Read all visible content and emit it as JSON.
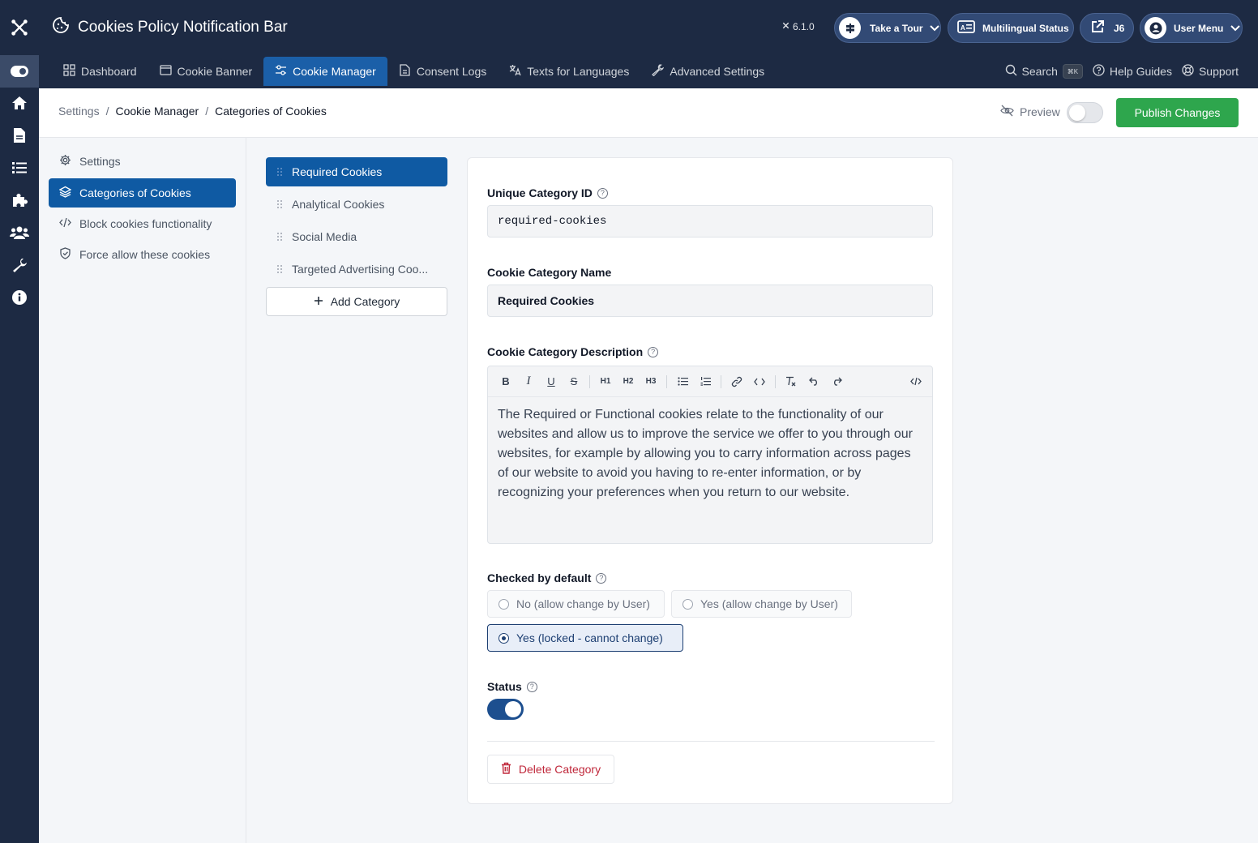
{
  "app": {
    "title": "Cookies Policy Notification Bar",
    "version": "6.1.0"
  },
  "header_pills": {
    "tour": "Take a Tour",
    "multilingual": "Multilingual Status",
    "site": "J6",
    "user": "User Menu"
  },
  "nav": {
    "tabs": [
      {
        "label": "Dashboard",
        "icon": "grid-icon"
      },
      {
        "label": "Cookie Banner",
        "icon": "window-icon"
      },
      {
        "label": "Cookie Manager",
        "icon": "sliders-icon",
        "active": true
      },
      {
        "label": "Consent Logs",
        "icon": "document-icon"
      },
      {
        "label": "Texts for Languages",
        "icon": "translate-icon"
      },
      {
        "label": "Advanced Settings",
        "icon": "wrench-icon"
      }
    ],
    "search": "Search",
    "search_kbd": "⌘K",
    "help": "Help Guides",
    "support": "Support"
  },
  "breadcrumb": [
    "Settings",
    "Cookie Manager",
    "Categories of Cookies"
  ],
  "preview_label": "Preview",
  "publish_label": "Publish Changes",
  "sidebar": {
    "items": [
      {
        "label": "Settings",
        "icon": "gear-icon"
      },
      {
        "label": "Categories of Cookies",
        "icon": "layers-icon",
        "active": true
      },
      {
        "label": "Block cookies functionality",
        "icon": "code-icon"
      },
      {
        "label": "Force allow these cookies",
        "icon": "shield-icon"
      }
    ]
  },
  "categories": {
    "items": [
      {
        "label": "Required Cookies",
        "active": true
      },
      {
        "label": "Analytical Cookies"
      },
      {
        "label": "Social Media"
      },
      {
        "label": "Targeted Advertising Coo..."
      }
    ],
    "add_label": "Add Category"
  },
  "form": {
    "id_label": "Unique Category ID",
    "id_value": "required-cookies",
    "name_label": "Cookie Category Name",
    "name_value": "Required Cookies",
    "desc_label": "Cookie Category Description",
    "desc_value": "The Required or Functional cookies relate to the functionality of our websites and allow us to improve the service we offer to you through our websites, for example by allowing you to carry information across pages of our website to avoid you having to re-enter information, or by recognizing your preferences when you return to our website.",
    "checked_label": "Checked by default",
    "options": [
      "No (allow change by User)",
      "Yes (allow change by User)",
      "Yes (locked - cannot change)"
    ],
    "selected_option": 2,
    "status_label": "Status",
    "status_on": true,
    "delete_label": "Delete Category"
  },
  "colors": {
    "header": "#1d2a43",
    "active": "#0f5aa3",
    "publish": "#2ea64d",
    "delete": "#c0283b"
  }
}
